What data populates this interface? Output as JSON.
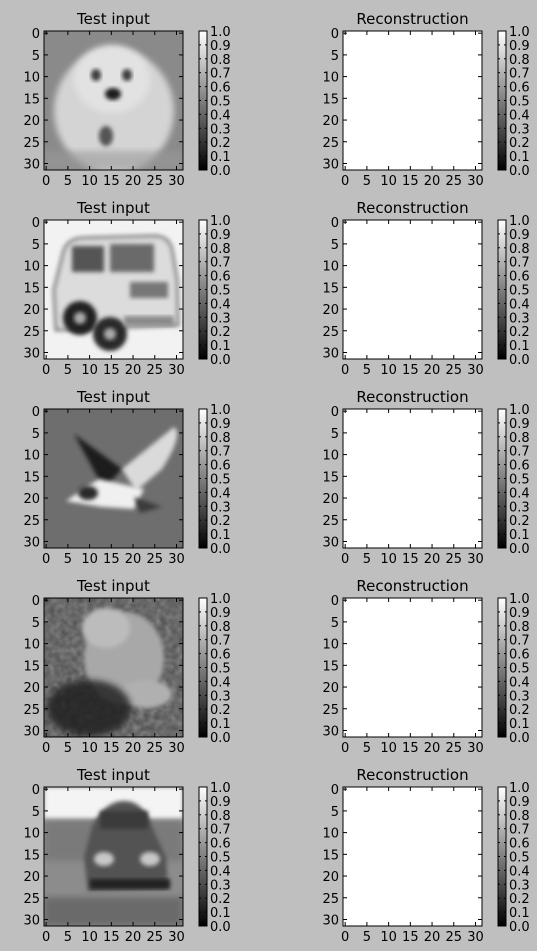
{
  "chart_data": [
    {
      "type": "heatmap",
      "title": "Test input",
      "image": "small white dog",
      "xticks": [
        "0",
        "5",
        "10",
        "15",
        "20",
        "25",
        "30"
      ],
      "yticks": [
        "0",
        "5",
        "10",
        "15",
        "20",
        "25",
        "30"
      ],
      "xlim": [
        0,
        31
      ],
      "ylim": [
        31,
        0
      ],
      "colorbar": {
        "ticks": [
          "0.0",
          "0.1",
          "0.2",
          "0.3",
          "0.4",
          "0.5",
          "0.6",
          "0.7",
          "0.8",
          "0.9",
          "1.0"
        ],
        "range": [
          0,
          1
        ],
        "colormap": "gray"
      }
    },
    {
      "type": "heatmap",
      "title": "Reconstruction",
      "image": "uniform white",
      "xticks": [
        "0",
        "5",
        "10",
        "15",
        "20",
        "25",
        "30"
      ],
      "yticks": [
        "0",
        "5",
        "10",
        "15",
        "20",
        "25",
        "30"
      ],
      "xlim": [
        0,
        31
      ],
      "ylim": [
        31,
        0
      ],
      "colorbar": {
        "ticks": [
          "0.0",
          "0.1",
          "0.2",
          "0.3",
          "0.4",
          "0.5",
          "0.6",
          "0.7",
          "0.8",
          "0.9",
          "1.0"
        ],
        "range": [
          0,
          1
        ],
        "colormap": "gray"
      }
    },
    {
      "type": "heatmap",
      "title": "Test input",
      "image": "car",
      "xticks": [
        "0",
        "5",
        "10",
        "15",
        "20",
        "25",
        "30"
      ],
      "yticks": [
        "0",
        "5",
        "10",
        "15",
        "20",
        "25",
        "30"
      ],
      "xlim": [
        0,
        31
      ],
      "ylim": [
        31,
        0
      ],
      "colorbar": {
        "ticks": [
          "0.0",
          "0.1",
          "0.2",
          "0.3",
          "0.4",
          "0.5",
          "0.6",
          "0.7",
          "0.8",
          "0.9",
          "1.0"
        ],
        "range": [
          0,
          1
        ],
        "colormap": "gray"
      }
    },
    {
      "type": "heatmap",
      "title": "Reconstruction",
      "image": "uniform white",
      "xticks": [
        "0",
        "5",
        "10",
        "15",
        "20",
        "25",
        "30"
      ],
      "yticks": [
        "0",
        "5",
        "10",
        "15",
        "20",
        "25",
        "30"
      ],
      "xlim": [
        0,
        31
      ],
      "ylim": [
        31,
        0
      ],
      "colorbar": {
        "ticks": [
          "0.0",
          "0.1",
          "0.2",
          "0.3",
          "0.4",
          "0.5",
          "0.6",
          "0.7",
          "0.8",
          "0.9",
          "1.0"
        ],
        "range": [
          0,
          1
        ],
        "colormap": "gray"
      }
    },
    {
      "type": "heatmap",
      "title": "Test input",
      "image": "bird in flight",
      "xticks": [
        "0",
        "5",
        "10",
        "15",
        "20",
        "25",
        "30"
      ],
      "yticks": [
        "0",
        "5",
        "10",
        "15",
        "20",
        "25",
        "30"
      ],
      "xlim": [
        0,
        31
      ],
      "ylim": [
        31,
        0
      ],
      "colorbar": {
        "ticks": [
          "0.0",
          "0.1",
          "0.2",
          "0.3",
          "0.4",
          "0.5",
          "0.6",
          "0.7",
          "0.8",
          "0.9",
          "1.0"
        ],
        "range": [
          0,
          1
        ],
        "colormap": "gray"
      }
    },
    {
      "type": "heatmap",
      "title": "Reconstruction",
      "image": "uniform white",
      "xticks": [
        "0",
        "5",
        "10",
        "15",
        "20",
        "25",
        "30"
      ],
      "yticks": [
        "0",
        "5",
        "10",
        "15",
        "20",
        "25",
        "30"
      ],
      "xlim": [
        0,
        31
      ],
      "ylim": [
        31,
        0
      ],
      "colorbar": {
        "ticks": [
          "0.0",
          "0.1",
          "0.2",
          "0.3",
          "0.4",
          "0.5",
          "0.6",
          "0.7",
          "0.8",
          "0.9",
          "1.0"
        ],
        "range": [
          0,
          1
        ],
        "colormap": "gray"
      }
    },
    {
      "type": "heatmap",
      "title": "Test input",
      "image": "frog",
      "xticks": [
        "0",
        "5",
        "10",
        "15",
        "20",
        "25",
        "30"
      ],
      "yticks": [
        "0",
        "5",
        "10",
        "15",
        "20",
        "25",
        "30"
      ],
      "xlim": [
        0,
        31
      ],
      "ylim": [
        31,
        0
      ],
      "colorbar": {
        "ticks": [
          "0.0",
          "0.1",
          "0.2",
          "0.3",
          "0.4",
          "0.5",
          "0.6",
          "0.7",
          "0.8",
          "0.9",
          "1.0"
        ],
        "range": [
          0,
          1
        ],
        "colormap": "gray"
      }
    },
    {
      "type": "heatmap",
      "title": "Reconstruction",
      "image": "uniform white",
      "xticks": [
        "0",
        "5",
        "10",
        "15",
        "20",
        "25",
        "30"
      ],
      "yticks": [
        "0",
        "5",
        "10",
        "15",
        "20",
        "25",
        "30"
      ],
      "xlim": [
        0,
        31
      ],
      "ylim": [
        31,
        0
      ],
      "colorbar": {
        "ticks": [
          "0.0",
          "0.1",
          "0.2",
          "0.3",
          "0.4",
          "0.5",
          "0.6",
          "0.7",
          "0.8",
          "0.9",
          "1.0"
        ],
        "range": [
          0,
          1
        ],
        "colormap": "gray"
      }
    },
    {
      "type": "heatmap",
      "title": "Test input",
      "image": "car front view",
      "xticks": [
        "0",
        "5",
        "10",
        "15",
        "20",
        "25",
        "30"
      ],
      "yticks": [
        "0",
        "5",
        "10",
        "15",
        "20",
        "25",
        "30"
      ],
      "xlim": [
        0,
        31
      ],
      "ylim": [
        31,
        0
      ],
      "colorbar": {
        "ticks": [
          "0.0",
          "0.1",
          "0.2",
          "0.3",
          "0.4",
          "0.5",
          "0.6",
          "0.7",
          "0.8",
          "0.9",
          "1.0"
        ],
        "range": [
          0,
          1
        ],
        "colormap": "gray"
      }
    },
    {
      "type": "heatmap",
      "title": "Reconstruction",
      "image": "uniform white",
      "xticks": [
        "0",
        "5",
        "10",
        "15",
        "20",
        "25",
        "30"
      ],
      "yticks": [
        "0",
        "5",
        "10",
        "15",
        "20",
        "25",
        "30"
      ],
      "xlim": [
        0,
        31
      ],
      "ylim": [
        31,
        0
      ],
      "colorbar": {
        "ticks": [
          "0.0",
          "0.1",
          "0.2",
          "0.3",
          "0.4",
          "0.5",
          "0.6",
          "0.7",
          "0.8",
          "0.9",
          "1.0"
        ],
        "range": [
          0,
          1
        ],
        "colormap": "gray"
      }
    }
  ],
  "colors": {
    "figure_background": "#bfbfbf",
    "reconstruction_fill": "#ffffff",
    "axis_color": "#000000"
  }
}
